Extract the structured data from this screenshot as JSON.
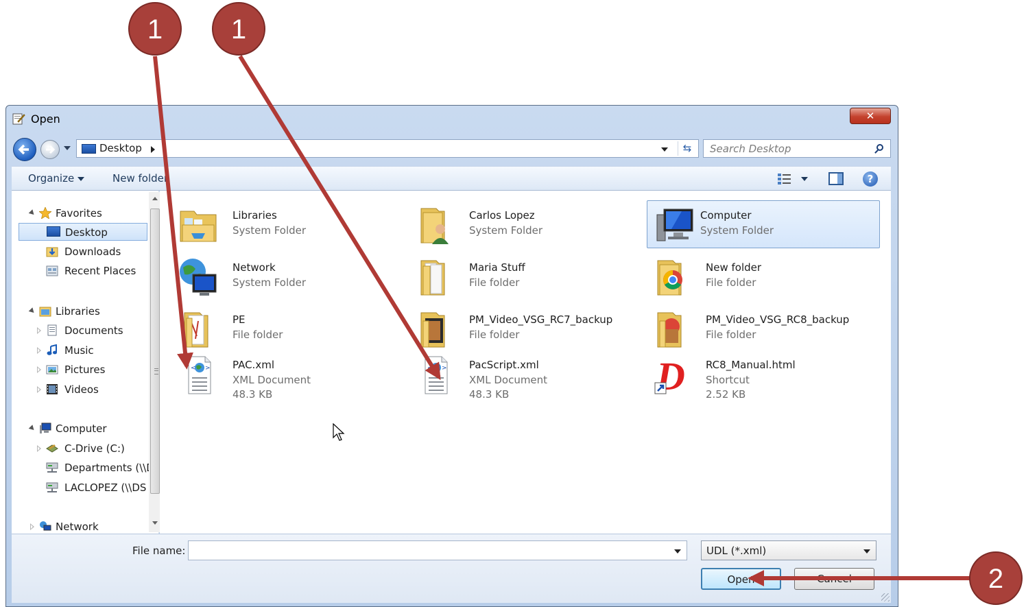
{
  "window": {
    "title": "Open",
    "close_glyph": "✕"
  },
  "address": {
    "location": "Desktop",
    "search_placeholder": "Search Desktop",
    "refresh_glyph": "⇆"
  },
  "toolbar": {
    "organize_label": "Organize",
    "new_folder_label": "New folder",
    "help_glyph": "?"
  },
  "nav": {
    "favorites": "Favorites",
    "desktop": "Desktop",
    "downloads": "Downloads",
    "recent": "Recent Places",
    "libraries": "Libraries",
    "documents": "Documents",
    "music": "Music",
    "pictures": "Pictures",
    "videos": "Videos",
    "computer": "Computer",
    "c_drive": "C-Drive (C:)",
    "departments": "Departments (\\\\D",
    "laclopez": "LACLOPEZ (\\\\DS",
    "network": "Network"
  },
  "items": [
    {
      "name": "Libraries",
      "type": "System Folder",
      "size": ""
    },
    {
      "name": "Carlos Lopez",
      "type": "System Folder",
      "size": ""
    },
    {
      "name": "Computer",
      "type": "System Folder",
      "size": ""
    },
    {
      "name": "Network",
      "type": "System Folder",
      "size": ""
    },
    {
      "name": "Maria Stuff",
      "type": "File folder",
      "size": ""
    },
    {
      "name": "New folder",
      "type": "File folder",
      "size": ""
    },
    {
      "name": "PE",
      "type": "File folder",
      "size": ""
    },
    {
      "name": "PM_Video_VSG_RC7_backup",
      "type": "File folder",
      "size": ""
    },
    {
      "name": "PM_Video_VSG_RC8_backup",
      "type": "File folder",
      "size": ""
    },
    {
      "name": "PAC.xml",
      "type": "XML Document",
      "size": "48.3 KB"
    },
    {
      "name": "PacScript.xml",
      "type": "XML Document",
      "size": "48.3 KB"
    },
    {
      "name": "RC8_Manual.html",
      "type": "Shortcut",
      "size": "2.52 KB"
    }
  ],
  "footer": {
    "file_name_label": "File name:",
    "file_name_value": "",
    "file_type": "UDL (*.xml)",
    "open_label": "Open",
    "cancel_label": "Cancel"
  },
  "annotations": {
    "step1": "1",
    "step2": "2",
    "color": "#b03a35"
  }
}
